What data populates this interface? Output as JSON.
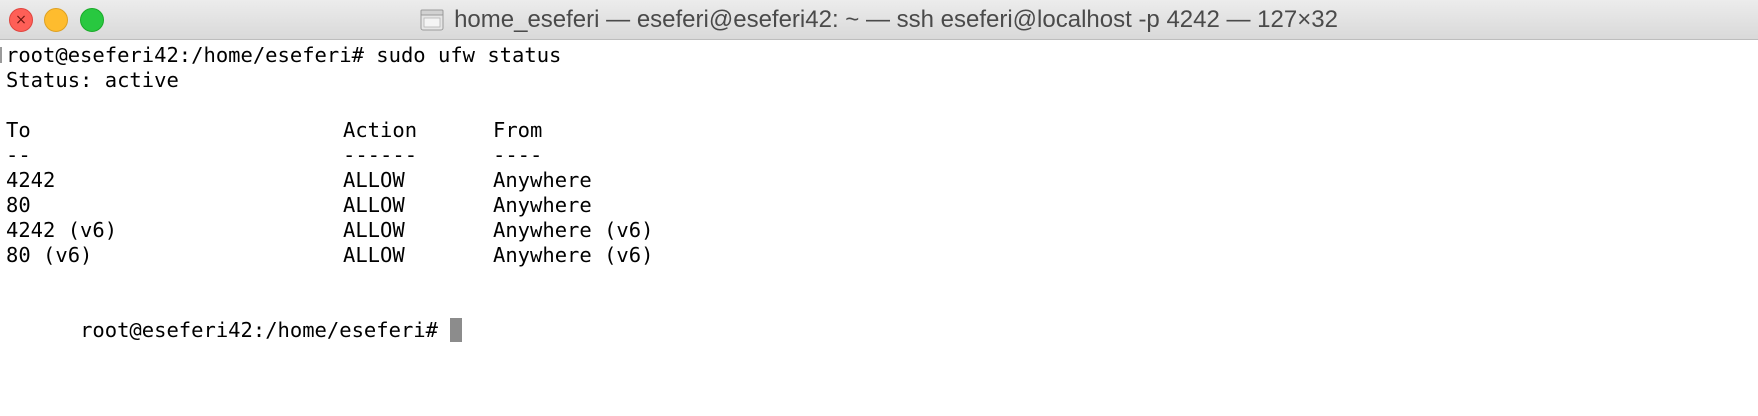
{
  "window": {
    "title": "home_eseferi — eseferi@eseferi42: ~ — ssh eseferi@localhost -p 4242 — 127×32",
    "controls": {
      "close_icon": "close-icon",
      "minimize_icon": "minimize-icon",
      "zoom_icon": "zoom-icon"
    },
    "folder_icon": "folder-icon"
  },
  "terminal": {
    "command_line": "root@eseferi42:/home/eseferi# sudo ufw status",
    "status_line": "Status: active",
    "headers": {
      "to": "To",
      "action": "Action",
      "from": "From"
    },
    "separators": {
      "to": "--",
      "action": "------",
      "from": "----"
    },
    "rows": [
      {
        "to": "4242",
        "action": "ALLOW",
        "from": "Anywhere"
      },
      {
        "to": "80",
        "action": "ALLOW",
        "from": "Anywhere"
      },
      {
        "to": "4242 (v6)",
        "action": "ALLOW",
        "from": "Anywhere (v6)"
      },
      {
        "to": "80 (v6)",
        "action": "ALLOW",
        "from": "Anywhere (v6)"
      }
    ],
    "prompt": "root@eseferi42:/home/eseferi#"
  },
  "colors": {
    "close": "#fe5f57",
    "minimize": "#febc2e",
    "zoom": "#28c840",
    "cursor": "#8c8c8c",
    "text": "#000000"
  }
}
